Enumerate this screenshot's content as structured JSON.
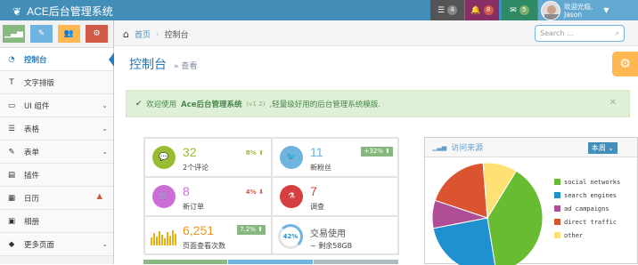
{
  "navbar": {
    "brand": "ACE后台管理系统",
    "tasks_count": "4",
    "notif_count": "8",
    "msg_count": "5",
    "welcome": "欢迎光临,",
    "user": "Jason"
  },
  "sidebar": {
    "items": [
      {
        "label": "控制台"
      },
      {
        "label": "文字排版"
      },
      {
        "label": "UI 组件"
      },
      {
        "label": "表格"
      },
      {
        "label": "表单"
      },
      {
        "label": "插件"
      },
      {
        "label": "日历"
      },
      {
        "label": "相册"
      },
      {
        "label": "更多页面"
      }
    ]
  },
  "breadcrumb": {
    "home": "首页",
    "current": "控制台"
  },
  "search": {
    "placeholder": "Search ..."
  },
  "page": {
    "title": "控制台",
    "subtitle": "查看"
  },
  "alert": {
    "pre": "欢迎使用",
    "strong": "Ace后台管理系统",
    "version": "(v1.2)",
    "post": ",轻量级好用的后台管理系统模版."
  },
  "stats": [
    {
      "num": "32",
      "label": "2个评论",
      "pct": "8%"
    },
    {
      "num": "11",
      "label": "新粉丝",
      "pct": "+32%"
    },
    {
      "num": "8",
      "label": "新订单",
      "pct": "4%"
    },
    {
      "num": "7",
      "label": "调查",
      "pct": ""
    },
    {
      "num": "6,251",
      "label": "页面查看次数",
      "pct": "7.2%"
    },
    {
      "num": "交易使用",
      "label": "~ 剩余58GB",
      "pct": "42%"
    }
  ],
  "widget": {
    "title": "访问来源",
    "button": "本周"
  },
  "chart_data": {
    "type": "pie",
    "categories": [
      "social networks",
      "search engines",
      "ad campaigns",
      "direct traffic",
      "other"
    ],
    "values": [
      38.7,
      24.5,
      8.2,
      18.6,
      10
    ],
    "colors": [
      "#68bc31",
      "#2091cf",
      "#af4e96",
      "#da5430",
      "#fee074"
    ]
  }
}
